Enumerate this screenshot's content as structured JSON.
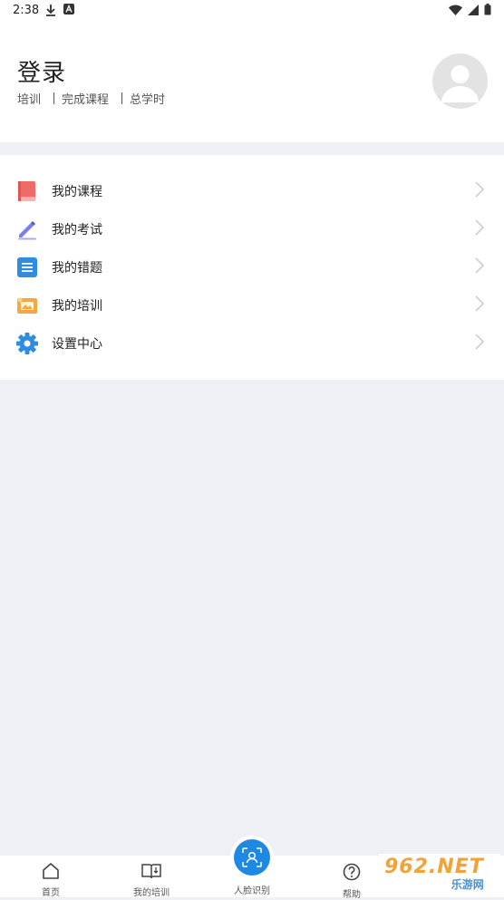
{
  "status_bar": {
    "time": "2:38"
  },
  "header": {
    "title": "登录",
    "stats": [
      "培训",
      "完成课程",
      "总学时"
    ]
  },
  "menu": [
    {
      "label": "我的课程",
      "icon": "book-icon",
      "color": "#f06a6a"
    },
    {
      "label": "我的考试",
      "icon": "pen-icon",
      "color": "#7b7df0"
    },
    {
      "label": "我的错题",
      "icon": "document-icon",
      "color": "#2f8ce0"
    },
    {
      "label": "我的培训",
      "icon": "training-icon",
      "color": "#f5a742"
    },
    {
      "label": "设置中心",
      "icon": "gear-icon",
      "color": "#2f8ce0"
    }
  ],
  "tabs": [
    {
      "label": "首页",
      "icon": "home-icon"
    },
    {
      "label": "我的培训",
      "icon": "open-book-icon"
    },
    {
      "label": "人脸识别",
      "icon": "face-recognition-icon"
    },
    {
      "label": "帮助",
      "icon": "help-icon"
    }
  ],
  "watermark": {
    "line1": "962.NET",
    "line2": "乐游网"
  },
  "colors": {
    "accent": "#1e88e5",
    "background": "#eef0f5"
  }
}
